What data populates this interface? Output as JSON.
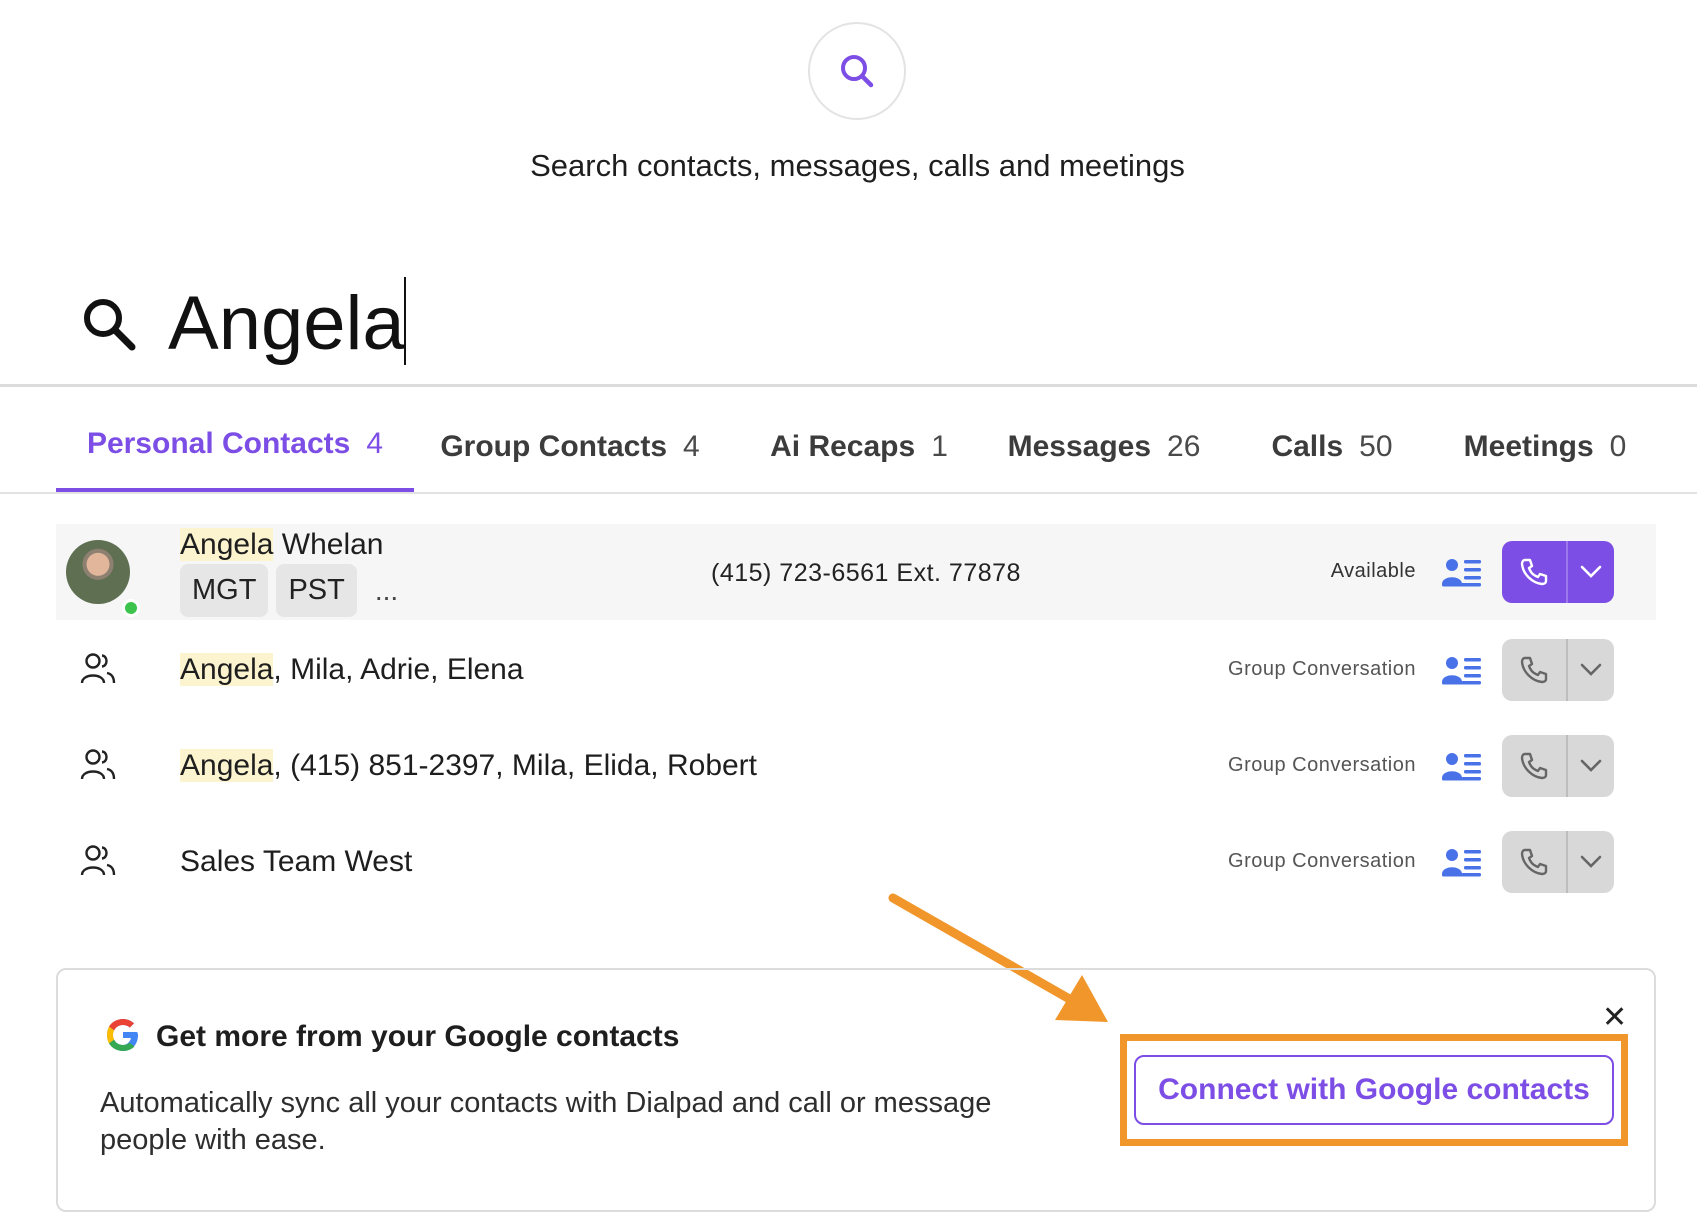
{
  "hero": {
    "text": "Search contacts, messages, calls and meetings"
  },
  "search": {
    "value": "Angela"
  },
  "tabs": [
    {
      "label": "Personal Contacts",
      "count": "4"
    },
    {
      "label": "Group Contacts",
      "count": "4"
    },
    {
      "label": "Ai Recaps",
      "count": "1"
    },
    {
      "label": "Messages",
      "count": "26"
    },
    {
      "label": "Calls",
      "count": "50"
    },
    {
      "label": "Meetings",
      "count": "0"
    }
  ],
  "results": [
    {
      "match": "Angela",
      "rest": " Whelan",
      "tags": [
        "MGT",
        "PST"
      ],
      "more": "...",
      "phone": "(415) 723-6561 Ext. 77878",
      "status": "Available"
    },
    {
      "match": "Angela",
      "rest": ", Mila, Adrie, Elena",
      "status": "Group Conversation"
    },
    {
      "match": "Angela",
      "rest": ", (415) 851-2397, Mila, Elida, Robert",
      "status": "Group Conversation"
    },
    {
      "match": "",
      "rest": "Sales Team West",
      "status": "Group Conversation"
    }
  ],
  "promo": {
    "title": "Get more from your Google contacts",
    "body": "Automatically sync all your contacts with Dialpad and call or message people with ease.",
    "close": "✕",
    "button": "Connect with Google contacts"
  },
  "colors": {
    "accent": "#7c4ee6",
    "highlight": "#fbf4cf",
    "annotation": "#f0962a",
    "presence": "#3cc34b"
  },
  "icons": [
    "search-icon",
    "group-icon",
    "contact-card-icon",
    "phone-icon",
    "chevron-down-icon",
    "google-icon",
    "close-icon",
    "annotation-arrow"
  ]
}
